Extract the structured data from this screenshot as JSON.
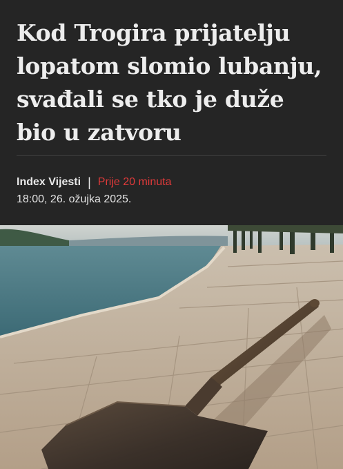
{
  "article": {
    "headline": "Kod Trogira prijatelju lopatom slomio lubanju, svađali se tko je duže bio u zatvoru",
    "source": "Index Vijesti",
    "separator": "|",
    "relative_time": "Prije 20 minuta",
    "datetime": "18:00, 26. ožujka 2025."
  },
  "colors": {
    "background": "#252525",
    "headline": "#ededed",
    "accent_red": "#e03a3a"
  },
  "hero_image": {
    "subject": "shovel-on-waterfront-promenade"
  }
}
